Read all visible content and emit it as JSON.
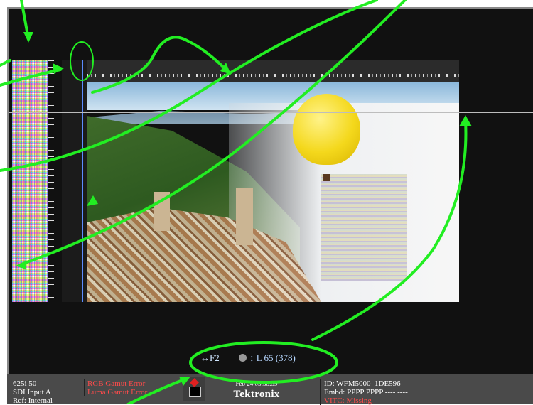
{
  "colors": {
    "annotation": "#22ee22",
    "error_text": "#ff4a4a",
    "cursor": "#5b8cff",
    "screen_bg": "#111111",
    "status_bg": "#4a4a4a"
  },
  "overlay": {
    "field": "↔F2",
    "line_label": "↕ L 65 (378)"
  },
  "status": {
    "format": "625i 50",
    "input": "SDI Input A",
    "ref": "Ref: Internal",
    "alarm1": "RGB Gamut Error",
    "alarm2": "Luma Gamut Error",
    "datetime": "Feb 24 03:58:59",
    "brand": "Tektronix",
    "id": "ID: WFM5000_1DE596",
    "embd": "Embd: PPPP PPPP ---- ----",
    "vitc": "VITC: Missing"
  },
  "icons": {
    "alarm": "alarm-warning-icon",
    "knob": "knob-icon"
  }
}
